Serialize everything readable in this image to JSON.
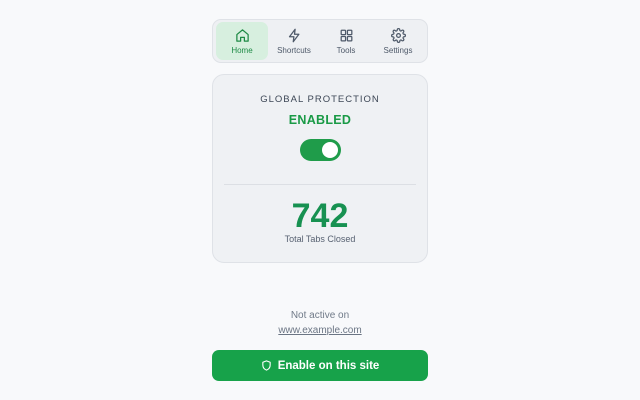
{
  "nav": {
    "tabs": [
      {
        "label": "Home",
        "icon": "home-icon",
        "active": true
      },
      {
        "label": "Shortcuts",
        "icon": "lightning-icon",
        "active": false
      },
      {
        "label": "Tools",
        "icon": "grid-icon",
        "active": false
      },
      {
        "label": "Settings",
        "icon": "gear-icon",
        "active": false
      }
    ]
  },
  "protection": {
    "title": "GLOBAL PROTECTION",
    "status": "ENABLED",
    "toggle_on": true
  },
  "stats": {
    "count": "742",
    "label": "Total Tabs Closed"
  },
  "site": {
    "status_text": "Not active on",
    "domain": "www.example.com"
  },
  "action": {
    "button_label": "Enable on this site",
    "icon": "shield-icon"
  },
  "colors": {
    "accent": "#17a24a",
    "active_tab_bg": "#d7efdf",
    "count_text": "#179151"
  }
}
